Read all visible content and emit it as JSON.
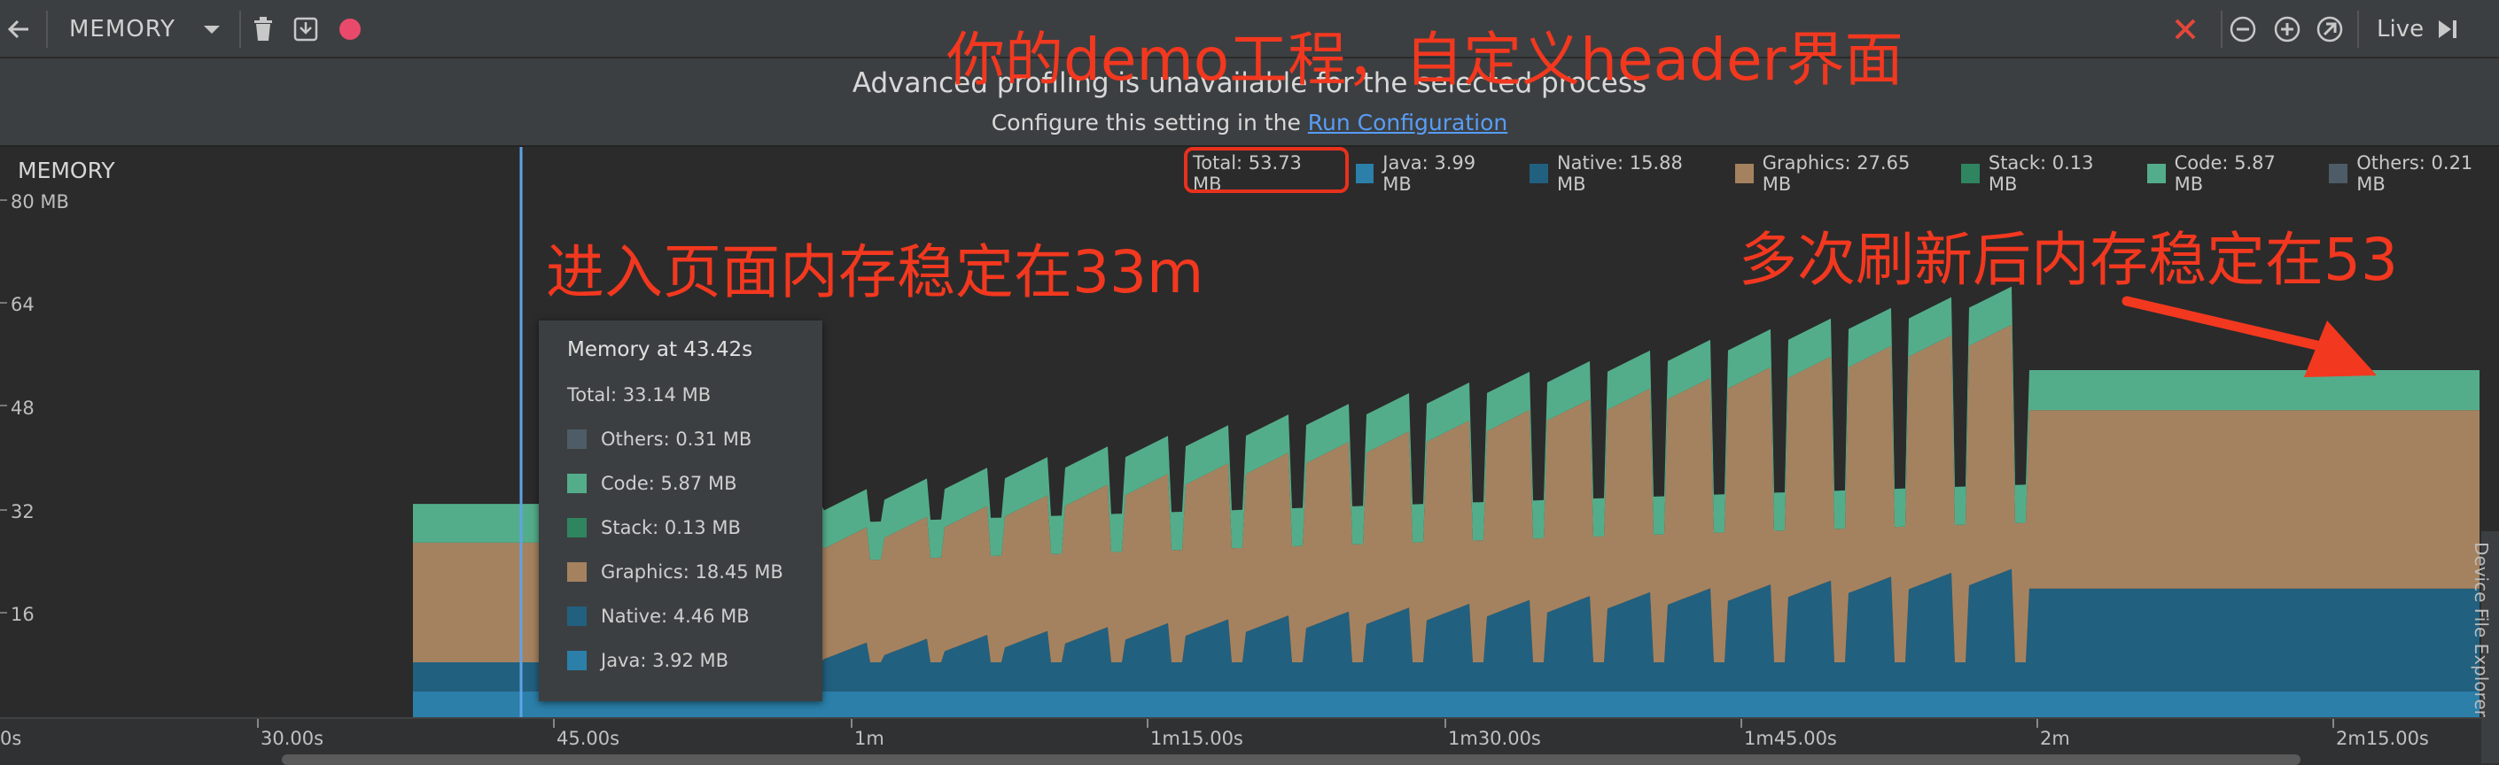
{
  "toolbar": {
    "session_label": "MEMORY",
    "live_label": "Live"
  },
  "banner": {
    "message": "Advanced profiling is unavailable for the selected process",
    "configure_prefix": "Configure this setting in the ",
    "configure_link": "Run Configuration"
  },
  "chart": {
    "title": "MEMORY",
    "y_ticks": [
      "80 MB",
      "64",
      "48",
      "32",
      "16"
    ],
    "legend": {
      "total": "Total: 53.73 MB",
      "java": "Java: 3.99 MB",
      "native": "Native: 15.88 MB",
      "graphics": "Graphics: 27.65 MB",
      "stack": "Stack: 0.13 MB",
      "code": "Code: 5.87 MB",
      "others": "Others: 0.21 MB"
    },
    "colors": {
      "java": "#2b7fa9",
      "native": "#22607f",
      "graphics": "#a5825f",
      "stack": "#2f8560",
      "code": "#54ad8a",
      "others": "#4d5c66"
    }
  },
  "tooltip": {
    "title": "Memory at 43.42s",
    "total": "Total: 33.14 MB",
    "others": "Others: 0.31 MB",
    "code": "Code: 5.87 MB",
    "stack": "Stack: 0.13 MB",
    "graphics": "Graphics: 18.45 MB",
    "native": "Native: 4.46 MB",
    "java": "Java: 3.92 MB"
  },
  "timeline": {
    "ticks": [
      "0s",
      "30.00s",
      "45.00s",
      "1m",
      "1m15.00s",
      "1m30.00s",
      "1m45.00s",
      "2m",
      "2m15.00s"
    ]
  },
  "annotations": {
    "header": "你的demo工程，自定义header界面",
    "enter": "进入页面内存稳定在33m",
    "refresh": "多次刷新后内存稳定在53"
  },
  "side_panel": {
    "label": "Device File Explorer"
  }
}
